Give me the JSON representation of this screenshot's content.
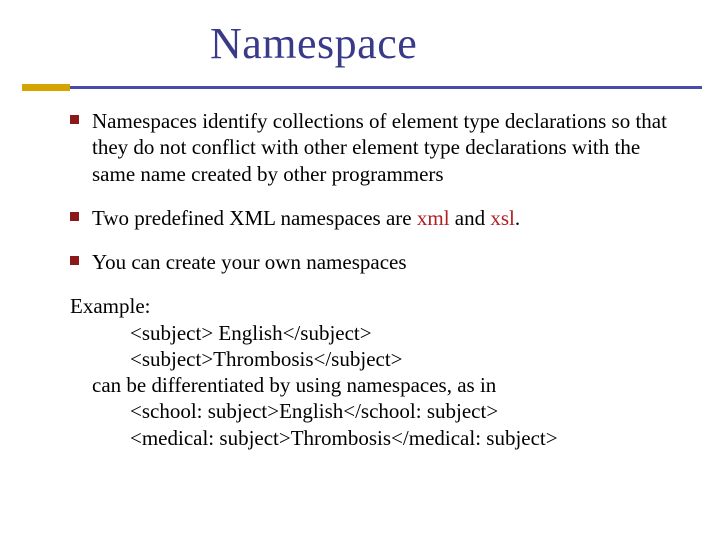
{
  "title": "Namespace",
  "bullets": {
    "b1_pre": "Namespaces identify collections of element type declarations so that they do not conflict with other element type declarations with the same name created by other programmers",
    "b2_pre": "Two predefined XML namespaces are ",
    "b2_term1": "xml",
    "b2_mid": " and ",
    "b2_term2": "xsl",
    "b2_post": ".",
    "b3": "You can create your own namespaces"
  },
  "example": {
    "label": "Example:",
    "line1": "<subject> English</subject>",
    "line2": "<subject>Thrombosis</subject>",
    "line3": "can be differentiated by using namespaces, as in",
    "line4": "<school: subject>English</school: subject>",
    "line5": "<medical: subject>Thrombosis</medical: subject>"
  }
}
